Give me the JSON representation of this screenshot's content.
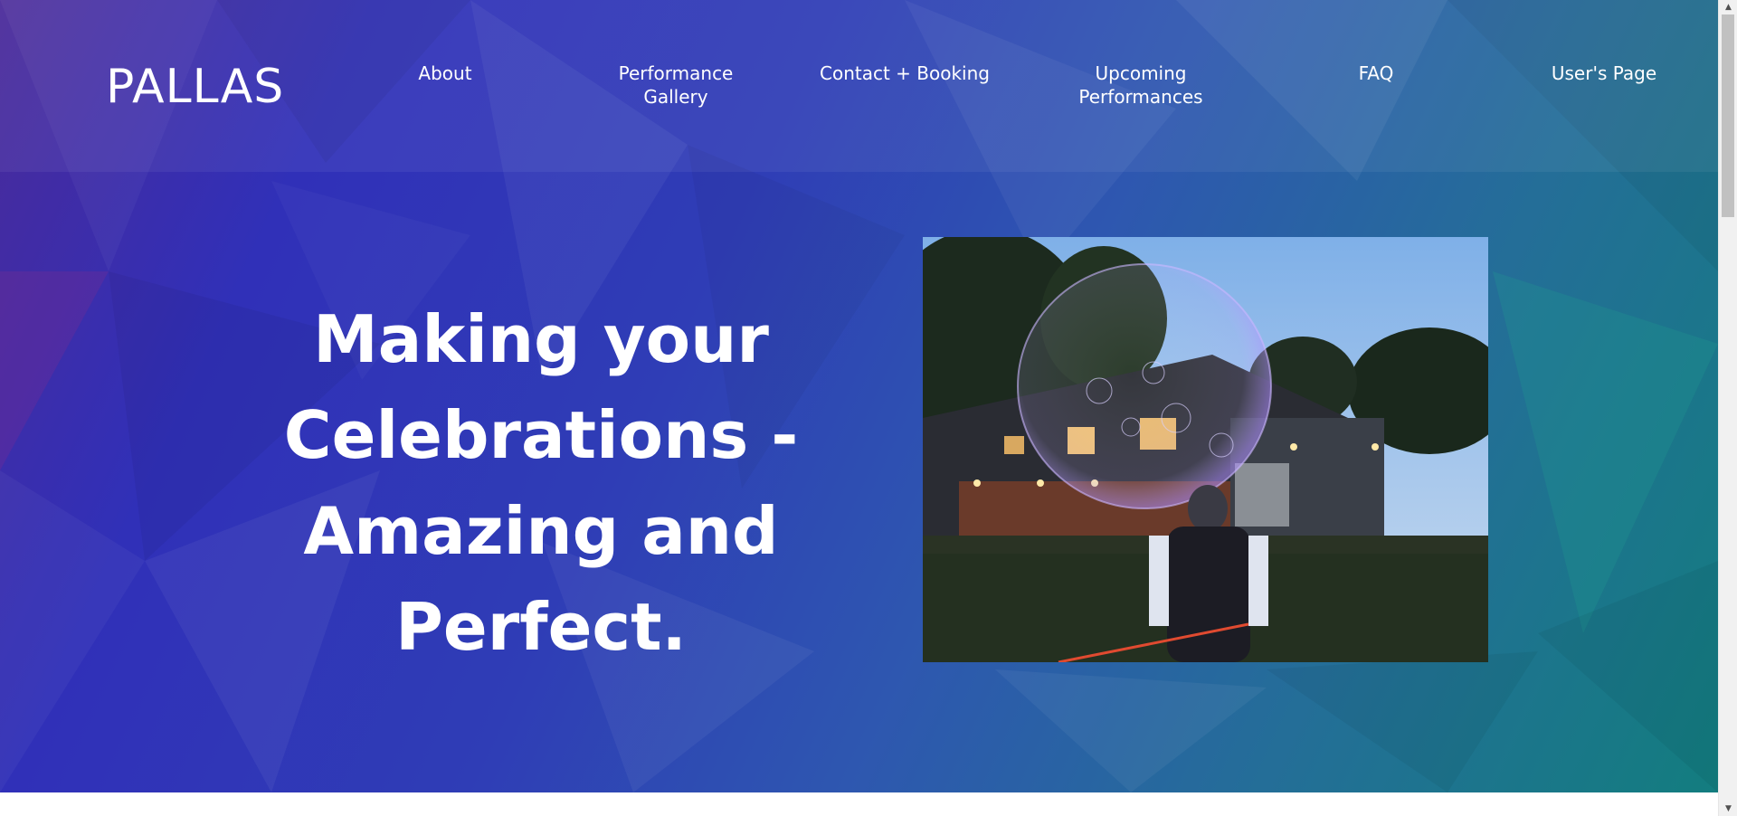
{
  "brand": {
    "logo_text": "PALLAS"
  },
  "nav": {
    "items": [
      {
        "label": "About"
      },
      {
        "label": "Performance Gallery"
      },
      {
        "label": "Contact + Booking"
      },
      {
        "label": "Upcoming Performances"
      },
      {
        "label": "FAQ"
      },
      {
        "label": "User's Page"
      }
    ]
  },
  "hero": {
    "headline": "Making your Celebrations - Amazing and Perfect."
  },
  "colors": {
    "hero_gradient_start": "#3030b8",
    "hero_gradient_end": "#137d7f",
    "text": "#ffffff"
  },
  "icons": {
    "scroll_up": "triangle-up-icon",
    "scroll_down": "triangle-down-icon"
  }
}
